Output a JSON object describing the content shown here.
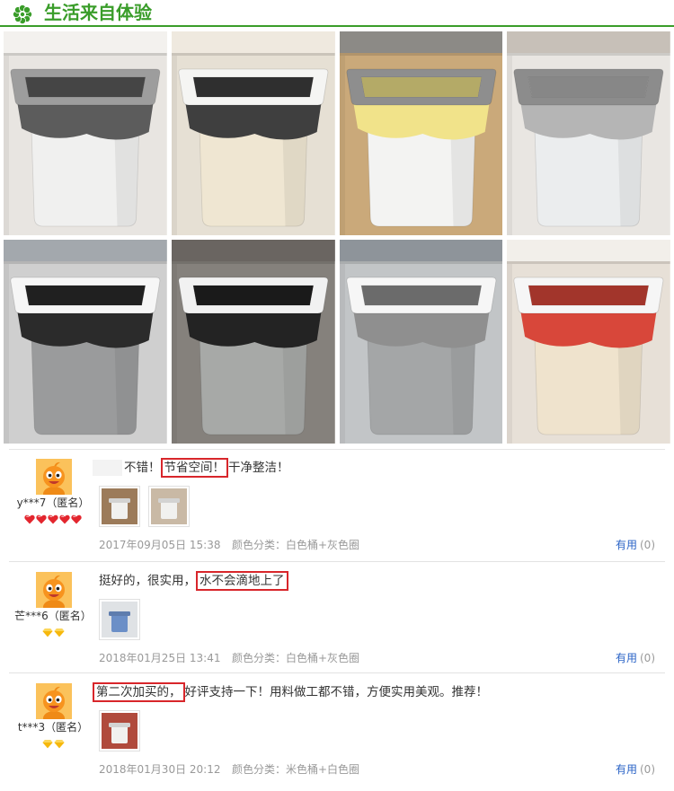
{
  "header": {
    "icon": "flower-icon",
    "title": "生活来自体验"
  },
  "colors": {
    "accent": "#3a9d2a",
    "text": "#333333",
    "highlight": "#d8262b",
    "link": "#2a63c6",
    "meta": "#999999",
    "heart": "#e3262e",
    "diamond": "#f6b80c"
  },
  "gallery": {
    "photos": [
      {
        "wall": "#e8e5e1",
        "top": "#f3f1ee",
        "bin": "#f0f0ef",
        "rim": "#9d9d9d",
        "bag": "#5c5c5c"
      },
      {
        "wall": "#e6e0d4",
        "top": "#efe9df",
        "bin": "#efe6d2",
        "rim": "#f5f5f3",
        "bag": "#3f3f3f"
      },
      {
        "wall": "#caa97a",
        "top": "#8c8a86",
        "bin": "#f3f3f2",
        "rim": "#8e8e8e",
        "bag": "#f1e38a"
      },
      {
        "wall": "#e9e6e2",
        "top": "#c7c0b8",
        "bin": "#ebedee",
        "rim": "#8c8c8c",
        "bag": "#b5b5b5"
      },
      {
        "wall": "#cfcfcf",
        "top": "#a3a8ad",
        "bin": "#9a9b9c",
        "rim": "#f6f6f6",
        "bag": "#2b2b2b"
      },
      {
        "wall": "#85817c",
        "top": "#6a6561",
        "bin": "#a7a9a7",
        "rim": "#f1f1f1",
        "bag": "#232323"
      },
      {
        "wall": "#c2c5c7",
        "top": "#8e949a",
        "bin": "#a4a6a7",
        "rim": "#f6f6f6",
        "bag": "#8f8f8f"
      },
      {
        "wall": "#e7e0d7",
        "top": "#f2efea",
        "bin": "#efe3cd",
        "rim": "#f6f6f6",
        "bag": "#d8473a"
      }
    ]
  },
  "reviews": [
    {
      "user": "y***7（匿名）",
      "rank": {
        "icon": "red-heart-icon",
        "count": 5
      },
      "segments": [
        "不错！",
        "节省空间！",
        "干净整洁！"
      ],
      "photos": [
        {
          "bg": "#9c7b5a",
          "fg": "#f1f1ef"
        },
        {
          "bg": "#c9b9a5",
          "fg": "#f1f1ef"
        }
      ],
      "date": "2017年09月05日 15:38",
      "sku": "颜色分类：白色桶+灰色圈",
      "useful_label": "有用",
      "useful_count": "(0)"
    },
    {
      "user": "芒***6（匿名）",
      "rank": {
        "icon": "yellow-diamond-icon",
        "count": 2
      },
      "segments": [
        "挺好的，很实用，",
        "水不会滴地上了"
      ],
      "photos": [
        {
          "bg": "#dfe2e5",
          "fg": "#6b8fc7"
        }
      ],
      "date": "2018年01月25日 13:41",
      "sku": "颜色分类：白色桶+灰色圈",
      "useful_label": "有用",
      "useful_count": "(0)"
    },
    {
      "user": "t***3（匿名）",
      "rank": {
        "icon": "yellow-diamond-icon",
        "count": 2
      },
      "segments": [
        "第二次加买的，",
        "好评支持一下！用料做工都不错，方便实用美观。推荐！"
      ],
      "photos": [
        {
          "bg": "#b04a3c",
          "fg": "#f1f1ef"
        }
      ],
      "date": "2018年01月30日 20:12",
      "sku": "颜色分类：米色桶+白色圈",
      "useful_label": "有用",
      "useful_count": "(0)"
    }
  ]
}
